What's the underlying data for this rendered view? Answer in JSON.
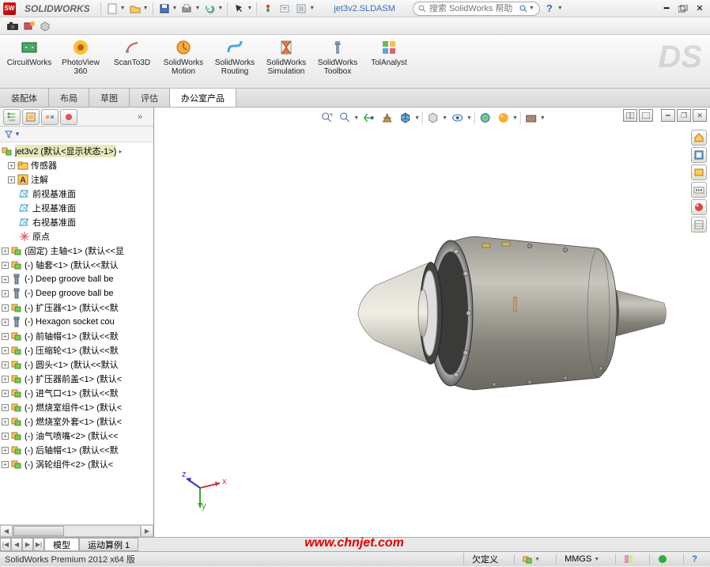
{
  "brand": "SOLIDWORKS",
  "doc_title": "jet3v2.SLDASM",
  "search_placeholder": "搜索 SolidWorks 帮助",
  "ribbon": [
    {
      "label": "CircuitWorks",
      "color": "#5a7"
    },
    {
      "label": "PhotoView 360",
      "color": "#fb3"
    },
    {
      "label": "ScanTo3D",
      "color": "#c55"
    },
    {
      "label": "SolidWorks Motion",
      "color": "#fa3"
    },
    {
      "label": "SolidWorks Routing",
      "color": "#4ad"
    },
    {
      "label": "SolidWorks Simulation",
      "color": "#e73"
    },
    {
      "label": "SolidWorks Toolbox",
      "color": "#89a"
    },
    {
      "label": "TolAnalyst",
      "color": "#6b5"
    }
  ],
  "main_tabs": [
    "装配体",
    "布局",
    "草图",
    "评估",
    "办公室产品"
  ],
  "active_tab_index": 4,
  "tree_root": "jet3v2  (默认<显示状态-1>)",
  "tree_fixed": [
    {
      "label": "传感器",
      "ico": "folder"
    },
    {
      "label": "注解",
      "ico": "annot"
    },
    {
      "label": "前视基准面",
      "ico": "plane"
    },
    {
      "label": "上视基准面",
      "ico": "plane"
    },
    {
      "label": "右视基准面",
      "ico": "plane"
    },
    {
      "label": "原点",
      "ico": "origin"
    }
  ],
  "tree_parts": [
    "(固定) 主轴<1> (默认<<显",
    "(-) 轴套<1> (默认<<默认",
    "(-) Deep groove ball be",
    "(-) Deep groove ball be",
    "(-) 扩压器<1> (默认<<默",
    "(-) Hexagon socket cou",
    "(-) 前轴帽<1> (默认<<默",
    "(-) 压缩轮<1> (默认<<默",
    "(-) 圆头<1> (默认<<默认",
    "(-) 扩压器前盖<1> (默认<",
    "(-) 进气口<1> (默认<<默",
    "(-) 燃烧室组件<1> (默认<",
    "(-) 燃烧室外套<1> (默认<",
    "(-) 油气喷嘴<2> (默认<<",
    "(-) 后轴帽<1> (默认<<默",
    "(-) 涡轮组件<2> (默认<"
  ],
  "bottom_tabs": [
    "模型",
    "运动算例 1"
  ],
  "watermark": "www.chnjet.com",
  "status_version": "SolidWorks Premium 2012 x64 版",
  "status_context": "欠定义",
  "status_units": "MMGS",
  "triad_labels": {
    "x": "x",
    "y": "y",
    "z": "z"
  }
}
